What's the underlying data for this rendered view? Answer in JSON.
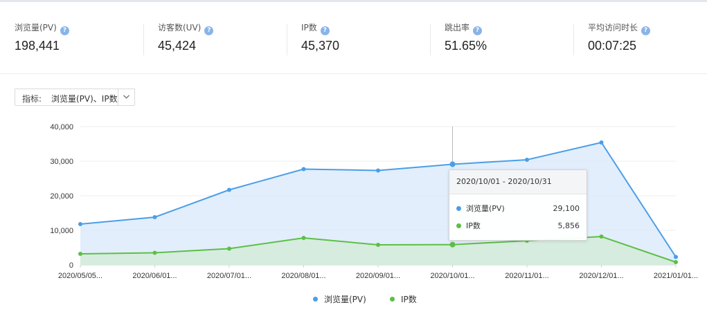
{
  "stats": [
    {
      "label": "浏览量(PV)",
      "value": "198,441"
    },
    {
      "label": "访客数(UV)",
      "value": "45,424"
    },
    {
      "label": "IP数",
      "value": "45,370"
    },
    {
      "label": "跳出率",
      "value": "51.65%"
    },
    {
      "label": "平均访问时长",
      "value": "00:07:25"
    }
  ],
  "help_icon_glyph": "?",
  "selector": {
    "label": "指标:",
    "value": "浏览量(PV)、IP数"
  },
  "colors": {
    "pv": "#4a9ee8",
    "ip": "#5cbf45",
    "pv_fill": "#ddebfa",
    "ip_fill": "#d3ebd9"
  },
  "tooltip": {
    "title": "2020/10/01 - 2020/10/31",
    "rows": [
      {
        "name": "浏览量(PV)",
        "value": "29,100"
      },
      {
        "name": "IP数",
        "value": "5,856"
      }
    ]
  },
  "legend": [
    {
      "name": "浏览量(PV)"
    },
    {
      "name": "IP数"
    }
  ],
  "chart_data": {
    "type": "area",
    "categories": [
      "2020/05/05...",
      "2020/06/01...",
      "2020/07/01...",
      "2020/08/01...",
      "2020/09/01...",
      "2020/10/01...",
      "2020/11/01...",
      "2020/12/01...",
      "2021/01/01..."
    ],
    "series": [
      {
        "name": "浏览量(PV)",
        "values": [
          11800,
          13800,
          21700,
          27700,
          27300,
          29100,
          30400,
          35400,
          2300
        ]
      },
      {
        "name": "IP数",
        "values": [
          3200,
          3500,
          4700,
          7800,
          5800,
          5856,
          7000,
          8200,
          800
        ]
      }
    ],
    "yticks": [
      "0",
      "10,000",
      "20,000",
      "30,000",
      "40,000"
    ],
    "ylim": [
      0,
      40000
    ],
    "highlight_index": 5,
    "grid": true,
    "legend_position": "bottom"
  }
}
